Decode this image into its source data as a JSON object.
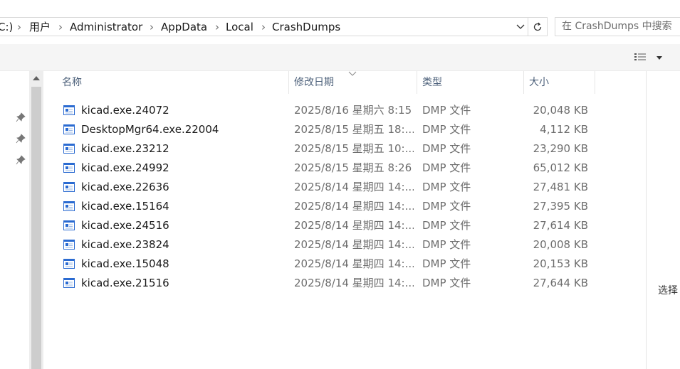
{
  "address": {
    "crumbs": [
      "C:)",
      "用户",
      "Administrator",
      "AppData",
      "Local",
      "CrashDumps"
    ],
    "separator": "›"
  },
  "search": {
    "placeholder": "在 CrashDumps 中搜索"
  },
  "toolbar": {
    "view_icon": "details-view-icon",
    "menu_icon": "chevron-down-icon"
  },
  "columns": {
    "name": "名称",
    "date": "修改日期",
    "type": "类型",
    "size": "大小"
  },
  "files": [
    {
      "name": "kicad.exe.24072",
      "date": "2025/8/16 星期六 8:15",
      "type": "DMP 文件",
      "size": "20,048 KB"
    },
    {
      "name": "DesktopMgr64.exe.22004",
      "date": "2025/8/15 星期五 18:...",
      "type": "DMP 文件",
      "size": "4,112 KB"
    },
    {
      "name": "kicad.exe.23212",
      "date": "2025/8/15 星期五 10:...",
      "type": "DMP 文件",
      "size": "23,290 KB"
    },
    {
      "name": "kicad.exe.24992",
      "date": "2025/8/15 星期五 8:26",
      "type": "DMP 文件",
      "size": "65,012 KB"
    },
    {
      "name": "kicad.exe.22636",
      "date": "2025/8/14 星期四 14:...",
      "type": "DMP 文件",
      "size": "27,481 KB"
    },
    {
      "name": "kicad.exe.15164",
      "date": "2025/8/14 星期四 14:...",
      "type": "DMP 文件",
      "size": "27,395 KB"
    },
    {
      "name": "kicad.exe.24516",
      "date": "2025/8/14 星期四 14:...",
      "type": "DMP 文件",
      "size": "27,614 KB"
    },
    {
      "name": "kicad.exe.23824",
      "date": "2025/8/14 星期四 14:...",
      "type": "DMP 文件",
      "size": "20,008 KB"
    },
    {
      "name": "kicad.exe.15048",
      "date": "2025/8/14 星期四 14:...",
      "type": "DMP 文件",
      "size": "20,153 KB"
    },
    {
      "name": "kicad.exe.21516",
      "date": "2025/8/14 星期四 14:...",
      "type": "DMP 文件",
      "size": "27,644 KB"
    }
  ],
  "preview": {
    "text": "选择"
  },
  "colors": {
    "accent": "#2b6bd1",
    "header_text": "#4c607a",
    "secondary_text": "#6d6d6d"
  }
}
